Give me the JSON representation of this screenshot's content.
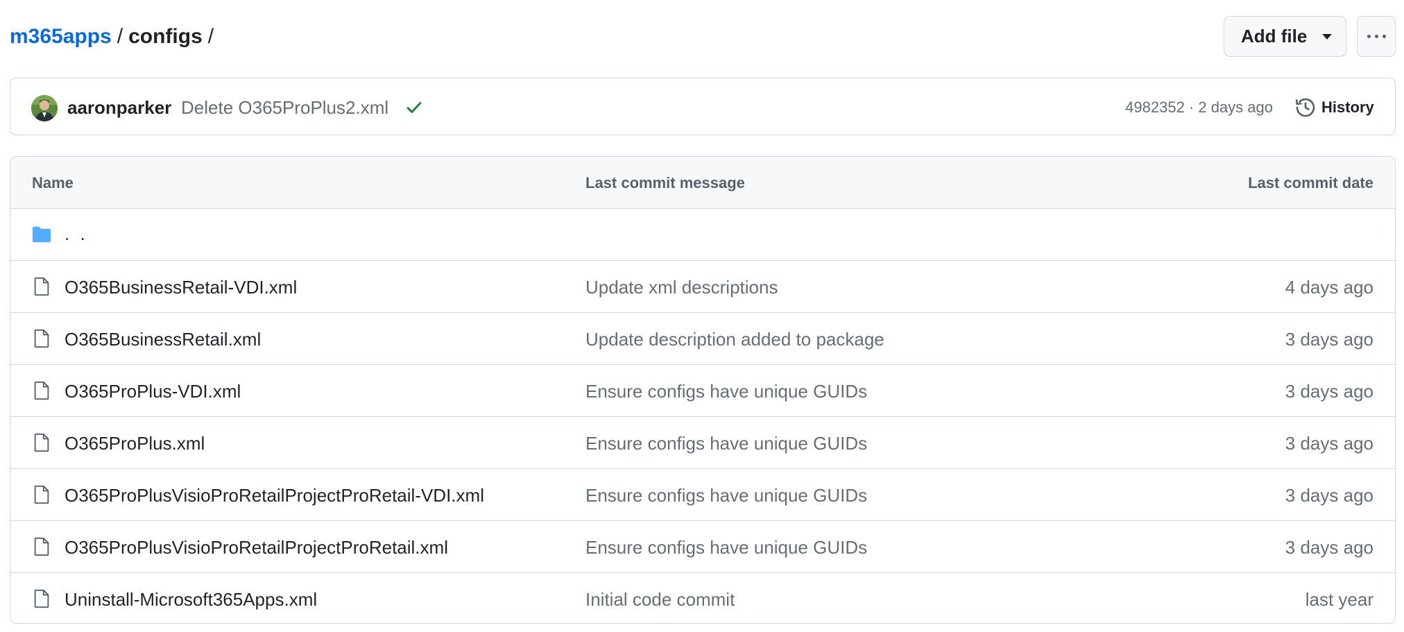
{
  "breadcrumb": {
    "repo": "m365apps",
    "separator": "/",
    "folder": "configs",
    "trailing_separator": "/"
  },
  "toolbar": {
    "add_file_label": "Add file",
    "more_icon": "kebab-horizontal-icon"
  },
  "latest_commit": {
    "author": "aaronparker",
    "message": "Delete O365ProPlus2.xml",
    "status_icon": "check-icon",
    "status_color": "#1a7f37",
    "meta": "4982352 · 2 days ago",
    "history_label": "History"
  },
  "table": {
    "headers": {
      "name": "Name",
      "message": "Last commit message",
      "date": "Last commit date"
    },
    "parent_row": {
      "label": ". .",
      "icon": "folder-icon",
      "icon_color": "#54aeff"
    },
    "rows": [
      {
        "name": "O365BusinessRetail-VDI.xml",
        "message": "Update xml descriptions",
        "date": "4 days ago"
      },
      {
        "name": "O365BusinessRetail.xml",
        "message": "Update description added to package",
        "date": "3 days ago"
      },
      {
        "name": "O365ProPlus-VDI.xml",
        "message": "Ensure configs have unique GUIDs",
        "date": "3 days ago"
      },
      {
        "name": "O365ProPlus.xml",
        "message": "Ensure configs have unique GUIDs",
        "date": "3 days ago"
      },
      {
        "name": "O365ProPlusVisioProRetailProjectProRetail-VDI.xml",
        "message": "Ensure configs have unique GUIDs",
        "date": "3 days ago"
      },
      {
        "name": "O365ProPlusVisioProRetailProjectProRetail.xml",
        "message": "Ensure configs have unique GUIDs",
        "date": "3 days ago"
      },
      {
        "name": "Uninstall-Microsoft365Apps.xml",
        "message": "Initial code commit",
        "date": "last year"
      }
    ]
  },
  "colors": {
    "link": "#0969da",
    "muted_text": "#656d76",
    "border": "#d0d7de",
    "header_bg": "#f6f8fa"
  }
}
